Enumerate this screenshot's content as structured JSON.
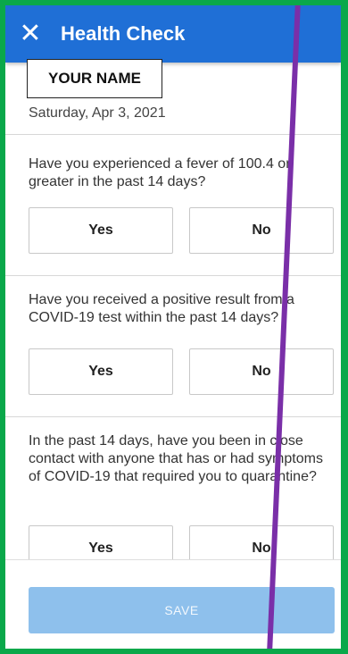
{
  "appbar": {
    "close_icon": "✕",
    "title": "Health Check"
  },
  "name_label": "YOUR NAME",
  "date": "Saturday, Apr 3, 2021",
  "questions": [
    {
      "text": "Have you experienced a fever of 100.4 or greater in the past 14 days?",
      "yes": "Yes",
      "no": "No"
    },
    {
      "text": "Have you received a positive result from a COVID-19 test within the past 14 days?",
      "yes": "Yes",
      "no": "No"
    },
    {
      "text": "In the past 14 days, have you been in close contact with anyone that has or had symptoms of COVID-19 that required you to quarantine?",
      "yes": "Yes",
      "no": "No"
    }
  ],
  "footer": {
    "save_label": "SAVE"
  },
  "colors": {
    "appbar": "#1f6fd6",
    "save_disabled": "#8ec0ec",
    "frame_border": "#0aa84a",
    "annotation_line": "#7a2fa8"
  }
}
